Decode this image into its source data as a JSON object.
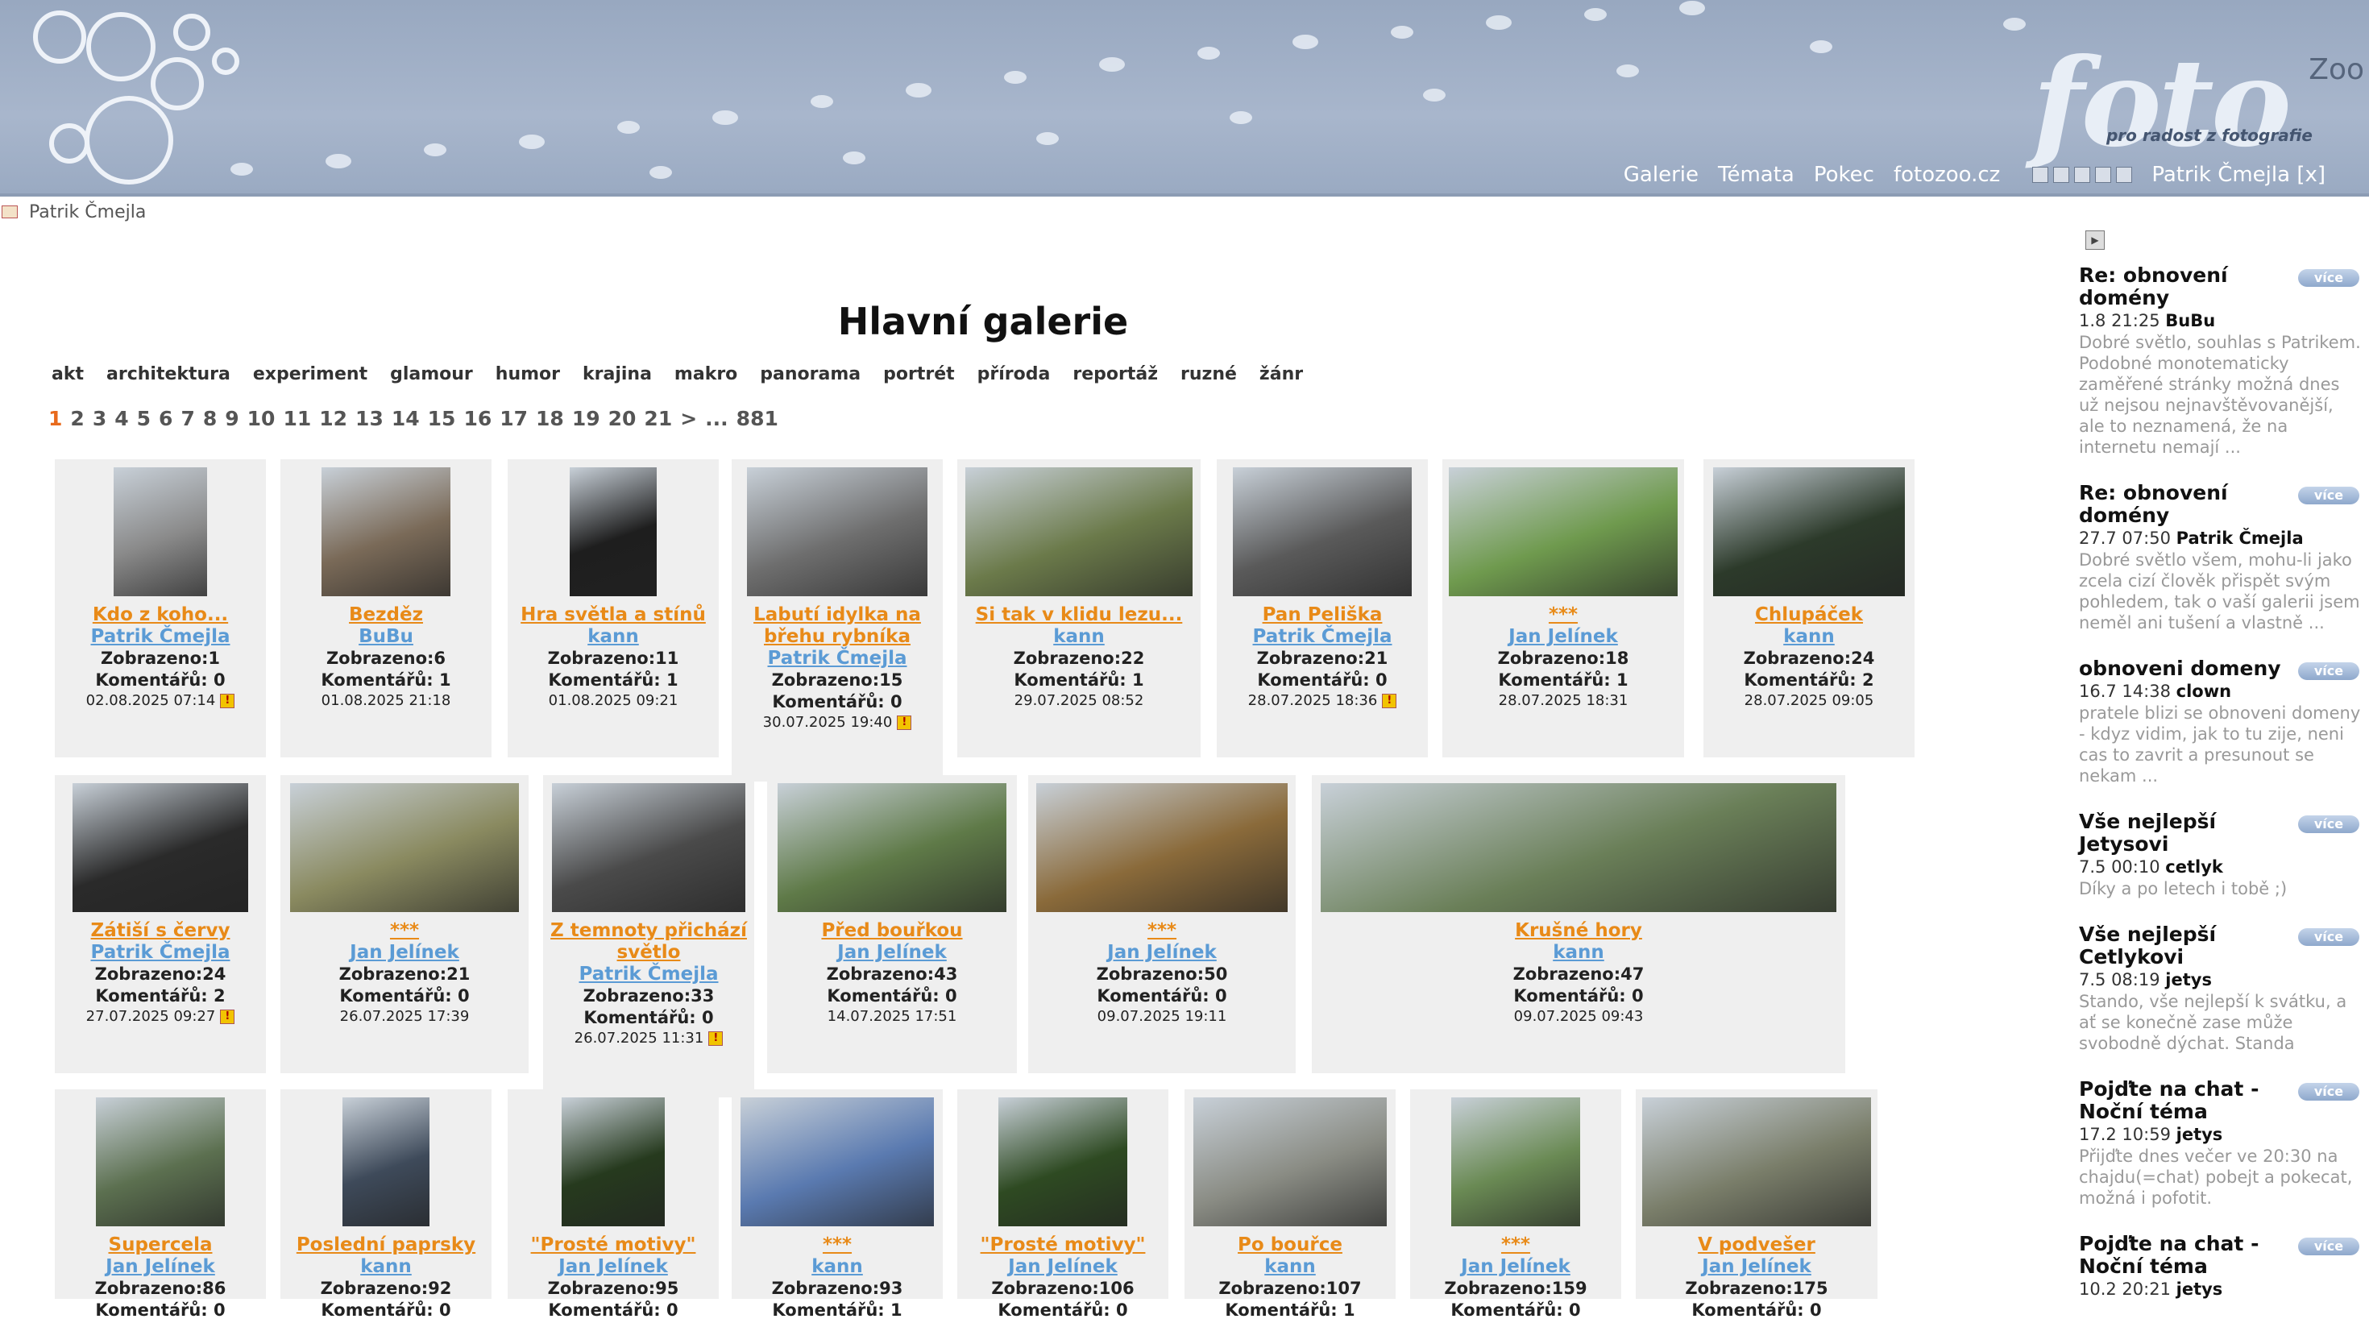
{
  "header": {
    "logo": "foto",
    "logo_zoo": "Zoo",
    "tagline": "pro radost z fotografie",
    "nav": [
      "Galerie",
      "Témata",
      "Pokec",
      "fotozoo.cz"
    ],
    "user": "Patrik Čmejla [x]"
  },
  "user_bar": {
    "name": "Patrik Čmejla"
  },
  "gallery": {
    "title": "Hlavní galerie",
    "categories": [
      "akt",
      "architektura",
      "experiment",
      "glamour",
      "humor",
      "krajina",
      "makro",
      "panorama",
      "portrét",
      "příroda",
      "reportáž",
      "ruzné",
      "žánr"
    ],
    "pages": [
      "1",
      "2",
      "3",
      "4",
      "5",
      "6",
      "7",
      "8",
      "9",
      "10",
      "11",
      "12",
      "13",
      "14",
      "15",
      "16",
      "17",
      "18",
      "19",
      "20",
      "21",
      ">",
      "...",
      "881"
    ],
    "photos": [
      {
        "title": "Kdo z koho...",
        "author": "Patrik Čmejla",
        "views": "Zobrazeno:1",
        "comments": "Komentářů: 0",
        "date": "02.08.2025 07:14",
        "warn": true,
        "color": "#8a8a8a"
      },
      {
        "title": "Bezděz",
        "author": "BuBu",
        "views": "Zobrazeno:6",
        "comments": "Komentářů: 1",
        "date": "01.08.2025 21:18",
        "warn": false,
        "color": "#7a6a58"
      },
      {
        "title": "Hra světla a stínů",
        "author": "kann",
        "views": "Zobrazeno:11",
        "comments": "Komentářů: 1",
        "date": "01.08.2025 09:21",
        "warn": false,
        "color": "#1e1e1e"
      },
      {
        "title": "Labutí idylka na břehu rybníka",
        "author": "Patrik Čmejla",
        "views": "Zobrazeno:15",
        "comments": "Komentářů: 0",
        "date": "30.07.2025 19:40",
        "warn": true,
        "color": "#6e6e6e"
      },
      {
        "title": "Si tak v klidu lezu...",
        "author": "kann",
        "views": "Zobrazeno:22",
        "comments": "Komentářů: 1",
        "date": "29.07.2025 08:52",
        "warn": false,
        "color": "#6b7a4a"
      },
      {
        "title": "Pan Peliška",
        "author": "Patrik Čmejla",
        "views": "Zobrazeno:21",
        "comments": "Komentářů: 0",
        "date": "28.07.2025 18:36",
        "warn": true,
        "color": "#5a5a5a"
      },
      {
        "title": "***",
        "author": "Jan Jelínek",
        "views": "Zobrazeno:18",
        "comments": "Komentářů: 1",
        "date": "28.07.2025 18:31",
        "warn": false,
        "color": "#6f9a4e"
      },
      {
        "title": "Chlupáček",
        "author": "kann",
        "views": "Zobrazeno:24",
        "comments": "Komentářů: 2",
        "date": "28.07.2025 09:05",
        "warn": false,
        "color": "#2c3a2a"
      },
      {
        "title": "Zátiší s červy",
        "author": "Patrik Čmejla",
        "views": "Zobrazeno:24",
        "comments": "Komentářů: 2",
        "date": "27.07.2025 09:27",
        "warn": true,
        "color": "#2a2a2a"
      },
      {
        "title": "***",
        "author": "Jan Jelínek",
        "views": "Zobrazeno:21",
        "comments": "Komentářů: 0",
        "date": "26.07.2025 17:39",
        "warn": false,
        "color": "#8a8a60"
      },
      {
        "title": "Z temnoty přichází světlo",
        "author": "Patrik Čmejla",
        "views": "Zobrazeno:33",
        "comments": "Komentářů: 0",
        "date": "26.07.2025 11:31",
        "warn": true,
        "color": "#4a4a4a"
      },
      {
        "title": "Před bouřkou",
        "author": "Jan Jelínek",
        "views": "Zobrazeno:43",
        "comments": "Komentářů: 0",
        "date": "14.07.2025 17:51",
        "warn": false,
        "color": "#5f7a48"
      },
      {
        "title": "***",
        "author": "Jan Jelínek",
        "views": "Zobrazeno:50",
        "comments": "Komentářů: 0",
        "date": "09.07.2025 19:11",
        "warn": false,
        "color": "#8a6a3a"
      },
      {
        "title": "Krušné hory",
        "author": "kann",
        "views": "Zobrazeno:47",
        "comments": "Komentářů: 0",
        "date": "09.07.2025 09:43",
        "warn": false,
        "color": "#6a7f58"
      },
      {
        "title": "Supercela",
        "author": "Jan Jelínek",
        "views": "Zobrazeno:86",
        "comments": "Komentářů: 0",
        "date": "",
        "warn": false,
        "color": "#5c7050"
      },
      {
        "title": "Poslední paprsky",
        "author": "kann",
        "views": "Zobrazeno:92",
        "comments": "Komentářů: 0",
        "date": "",
        "warn": false,
        "color": "#3e4a5a"
      },
      {
        "title": "\"Prosté motivy\"",
        "author": "Jan Jelínek",
        "views": "Zobrazeno:95",
        "comments": "Komentářů: 0",
        "date": "",
        "warn": false,
        "color": "#263a1e"
      },
      {
        "title": "***",
        "author": "kann",
        "views": "Zobrazeno:93",
        "comments": "Komentářů: 1",
        "date": "",
        "warn": false,
        "color": "#5a7ab0"
      },
      {
        "title": "\"Prosté motivy\"",
        "author": "Jan Jelínek",
        "views": "Zobrazeno:106",
        "comments": "Komentářů: 0",
        "date": "",
        "warn": false,
        "color": "#2e4a22"
      },
      {
        "title": "Po bouřce",
        "author": "kann",
        "views": "Zobrazeno:107",
        "comments": "Komentářů: 1",
        "date": "",
        "warn": false,
        "color": "#8a8c84"
      },
      {
        "title": "***",
        "author": "Jan Jelínek",
        "views": "Zobrazeno:159",
        "comments": "Komentářů: 0",
        "date": "",
        "warn": false,
        "color": "#6a8a54"
      },
      {
        "title": "V podvešer",
        "author": "Jan Jelínek",
        "views": "Zobrazeno:175",
        "comments": "Komentářů: 0",
        "date": "",
        "warn": false,
        "color": "#7a7e6a"
      }
    ]
  },
  "sidebar": {
    "more_label": "více",
    "posts": [
      {
        "title": "Re: obnovení domény",
        "time": "1.8 21:25",
        "user": "BuBu",
        "text": "Dobré světlo, souhlas s Patrikem. Podobné monotematicky zaměřené stránky možná dnes už nejsou nejnavštěvovanější, ale to neznamená, že na internetu nemají ..."
      },
      {
        "title": "Re: obnovení domény",
        "time": "27.7 07:50",
        "user": "Patrik Čmejla",
        "text": "Dobré světlo všem, mohu-li jako zcela cizí člověk přispět svým pohledem, tak o vaší galerii jsem neměl ani tušení a vlastně ..."
      },
      {
        "title": "obnoveni domeny",
        "time": "16.7 14:38",
        "user": "clown",
        "text": "pratele blizi se obnoveni domeny - kdyz vidim, jak to tu zije, neni cas to zavrit a presunout se nekam ..."
      },
      {
        "title": "Vše nejlepší Jetysovi",
        "time": "7.5 00:10",
        "user": "cetlyk",
        "text": "Díky a po letech i tobě ;)"
      },
      {
        "title": "Vše nejlepší Cetlykovi",
        "time": "7.5 08:19",
        "user": "jetys",
        "text": "Stando, vše nejlepší k svátku, a ať se konečně zase může svobodně dýchat. Standa"
      },
      {
        "title": "Pojďte na chat - Noční téma",
        "time": "17.2 10:59",
        "user": "jetys",
        "text": "Přijďte dnes večer ve 20:30 na chajdu(=chat) pobejt a pokecat, možná i pofotit."
      },
      {
        "title": "Pojďte na chat - Noční téma",
        "time": "10.2 20:21",
        "user": "jetys",
        "text": ""
      }
    ]
  }
}
